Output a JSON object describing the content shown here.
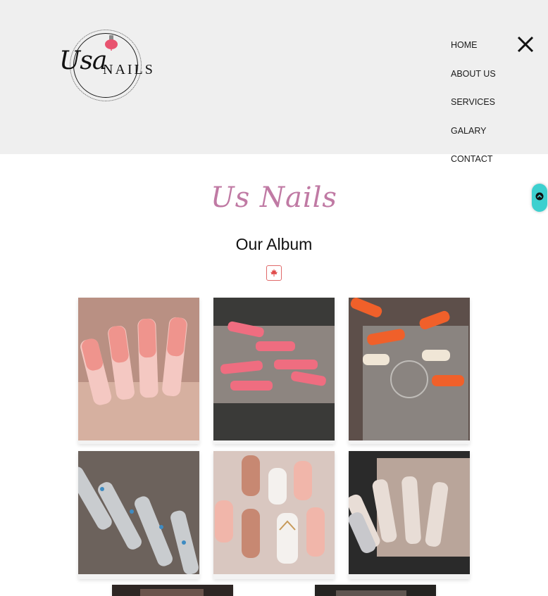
{
  "header": {
    "logo": {
      "script": "Usa",
      "word": "NAILS"
    },
    "nav": [
      "HOME",
      "ABOUT US",
      "SERVICES",
      "GALARY",
      "CONTACT"
    ]
  },
  "main": {
    "brand_title": "Us Nails",
    "section_title": "Our Album"
  },
  "colors": {
    "header_bg": "#efefef",
    "brand_pink": "#c07aa4",
    "scroll_button": "#3dd0cf",
    "maple_red": "#e06a6a"
  },
  "icons": {
    "close": "close-icon",
    "scroll_top": "chevron-up-icon",
    "badge": "maple-leaf-icon"
  },
  "gallery": [
    {
      "name": "pink-glitter-ombre-nails"
    },
    {
      "name": "coral-pink-coffin-nails"
    },
    {
      "name": "orange-dreamcatcher-nails"
    },
    {
      "name": "blue-butterfly-nails"
    },
    {
      "name": "rose-gold-chevron-nails"
    },
    {
      "name": "chrome-rhinestone-nails"
    },
    {
      "name": "gallery-photo-7"
    },
    {
      "name": "gallery-photo-8"
    }
  ]
}
